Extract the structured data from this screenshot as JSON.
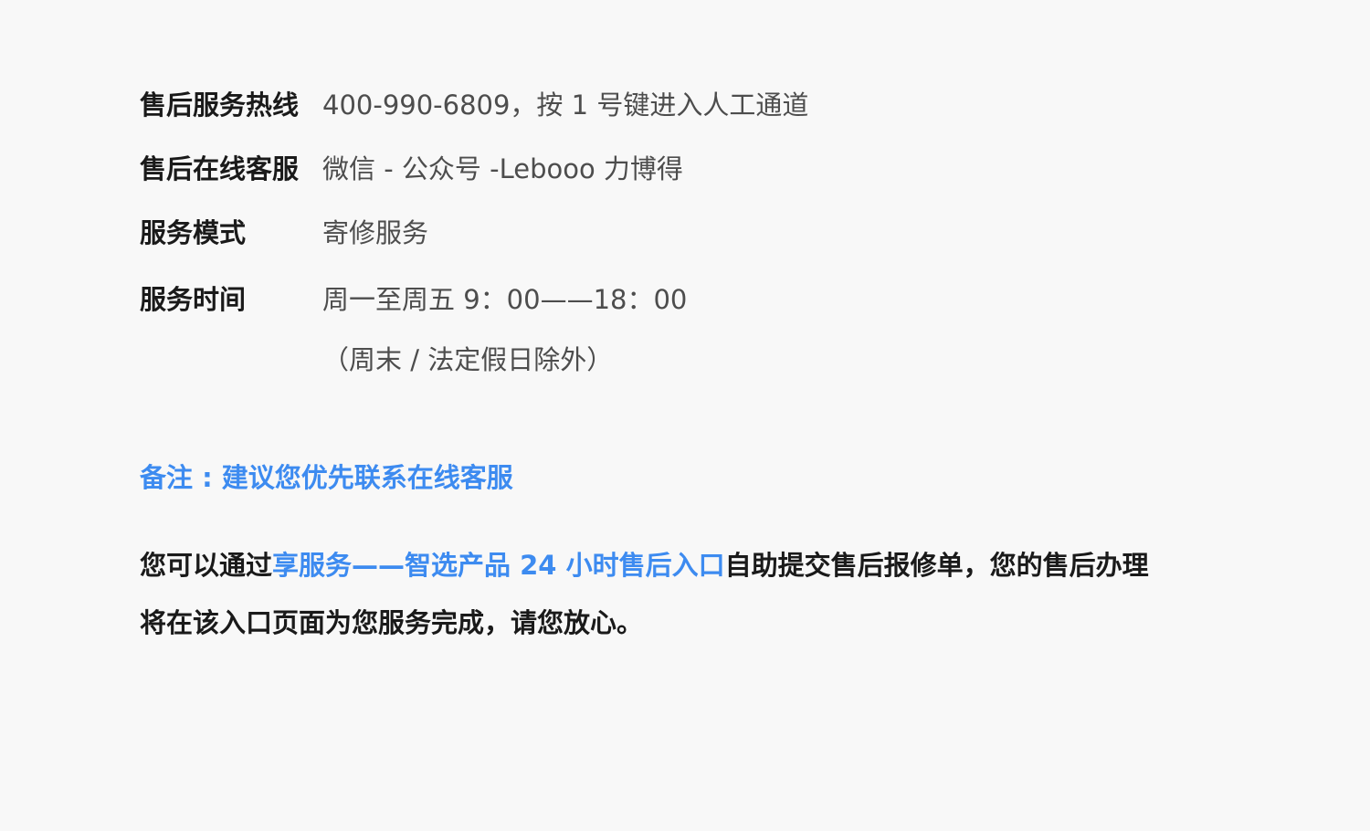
{
  "rows": [
    {
      "label": "售后服务热线",
      "value": "400-990-6809，按 1 号键进入人工通道"
    },
    {
      "label": "售后在线客服",
      "value": "微信 - 公众号 -Lebooo 力博得"
    },
    {
      "label": "服务模式",
      "value": "寄修服务"
    },
    {
      "label": "服务时间",
      "value": "周一至周五 9：00——18：00",
      "value_extra": "（周末 / 法定假日除外）"
    }
  ],
  "note": "备注 : 建议您优先联系在线客服",
  "paragraph": {
    "prefix": "您可以通过",
    "link_text": "享服务——智选产品 24 小时售后入口",
    "suffix_line1": "自助提交售后报修单，您的售后办理",
    "line2": "将在该入口页面为您服务完成，请您放心。"
  },
  "colors": {
    "accent": "#3d8bf0",
    "text": "#1a1a1a",
    "muted": "#4d4d4d",
    "background": "#f8f8f8"
  }
}
